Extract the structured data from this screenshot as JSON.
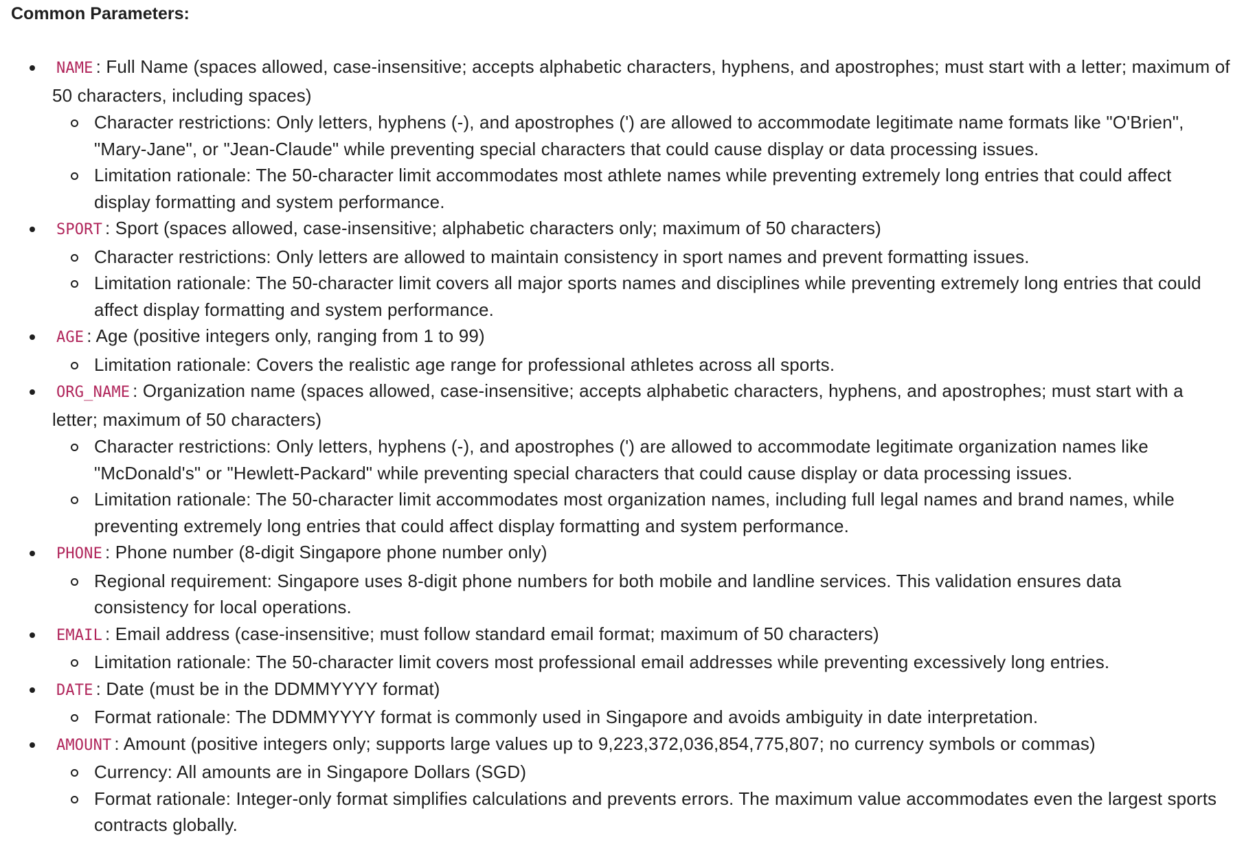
{
  "heading": "Common Parameters:",
  "params": [
    {
      "code": "NAME",
      "description": ": Full Name (spaces allowed, case-insensitive; accepts alphabetic characters, hyphens, and apostrophes; must start with a letter; maximum of 50 characters, including spaces)",
      "notes": [
        "Character restrictions: Only letters, hyphens (-), and apostrophes (') are allowed to accommodate legitimate name formats like \"O'Brien\", \"Mary-Jane\", or \"Jean-Claude\" while preventing special characters that could cause display or data processing issues.",
        "Limitation rationale: The 50-character limit accommodates most athlete names while preventing extremely long entries that could affect display formatting and system performance."
      ]
    },
    {
      "code": "SPORT",
      "description": ": Sport (spaces allowed, case-insensitive; alphabetic characters only; maximum of 50 characters)",
      "notes": [
        "Character restrictions: Only letters are allowed to maintain consistency in sport names and prevent formatting issues.",
        "Limitation rationale: The 50-character limit covers all major sports names and disciplines while preventing extremely long entries that could affect display formatting and system performance."
      ]
    },
    {
      "code": "AGE",
      "description": ": Age (positive integers only, ranging from 1 to 99)",
      "notes": [
        "Limitation rationale: Covers the realistic age range for professional athletes across all sports."
      ]
    },
    {
      "code": "ORG_NAME",
      "description": ": Organization name (spaces allowed, case-insensitive; accepts alphabetic characters, hyphens, and apostrophes; must start with a letter; maximum of 50 characters)",
      "notes": [
        "Character restrictions: Only letters, hyphens (-), and apostrophes (') are allowed to accommodate legitimate organization names like \"McDonald's\" or \"Hewlett-Packard\" while preventing special characters that could cause display or data processing issues.",
        "Limitation rationale: The 50-character limit accommodates most organization names, including full legal names and brand names, while preventing extremely long entries that could affect display formatting and system performance."
      ]
    },
    {
      "code": "PHONE",
      "description": ": Phone number (8-digit Singapore phone number only)",
      "notes": [
        "Regional requirement: Singapore uses 8-digit phone numbers for both mobile and landline services. This validation ensures data consistency for local operations."
      ]
    },
    {
      "code": "EMAIL",
      "description": ": Email address (case-insensitive; must follow standard email format; maximum of 50 characters)",
      "notes": [
        "Limitation rationale: The 50-character limit covers most professional email addresses while preventing excessively long entries."
      ]
    },
    {
      "code": "DATE",
      "description": ": Date (must be in the DDMMYYYY format)",
      "notes": [
        "Format rationale: The DDMMYYYY format is commonly used in Singapore and avoids ambiguity in date interpretation."
      ]
    },
    {
      "code": "AMOUNT",
      "description": ": Amount (positive integers only; supports large values up to 9,223,372,036,854,775,807; no currency symbols or commas)",
      "notes": [
        "Currency: All amounts are in Singapore Dollars (SGD)",
        "Format rationale: Integer-only format simplifies calculations and prevents errors. The maximum value accommodates even the largest sports contracts globally."
      ]
    }
  ]
}
